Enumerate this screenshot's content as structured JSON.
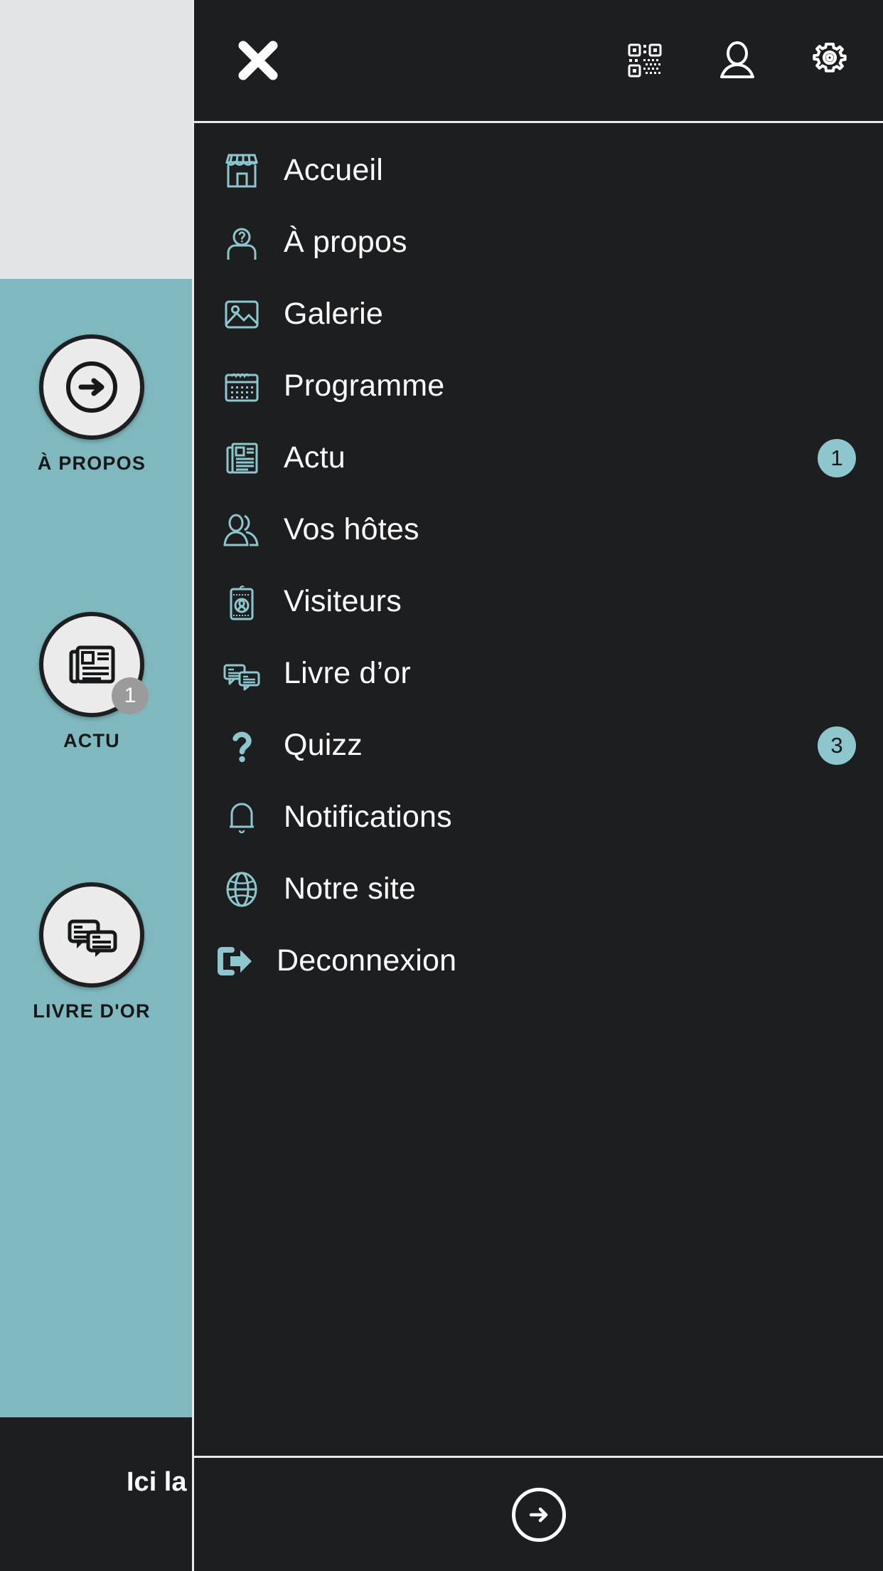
{
  "background": {
    "nav_buttons": [
      {
        "label": "À PROPOS",
        "icon": "arrow-circle-right-icon",
        "badge": null
      },
      {
        "label": "ACTU",
        "icon": "newspaper-icon",
        "badge": "1"
      },
      {
        "label": "LIVRE D'OR",
        "icon": "chat-bubbles-icon",
        "badge": null
      }
    ],
    "bottom_text": "Ici la",
    "colors": {
      "top_panel": "#e3e4e5",
      "teal_panel": "#7fb9bf",
      "bottom_bar": "#1c1e20"
    }
  },
  "drawer": {
    "header": {
      "close_icon": "close-x-icon",
      "icons": [
        {
          "name": "qr-code-icon"
        },
        {
          "name": "user-profile-icon"
        },
        {
          "name": "settings-gear-icon"
        }
      ]
    },
    "menu": [
      {
        "label": "Accueil",
        "icon": "storefront-icon",
        "badge": null
      },
      {
        "label": "À propos",
        "icon": "person-question-icon",
        "badge": null
      },
      {
        "label": "Galerie",
        "icon": "image-photo-icon",
        "badge": null
      },
      {
        "label": "Programme",
        "icon": "calendar-icon",
        "badge": null
      },
      {
        "label": "Actu",
        "icon": "newspaper-icon",
        "badge": "1"
      },
      {
        "label": "Vos hôtes",
        "icon": "two-people-icon",
        "badge": null
      },
      {
        "label": "Visiteurs",
        "icon": "id-badge-icon",
        "badge": null
      },
      {
        "label": "Livre d’or",
        "icon": "chat-bubbles-icon",
        "badge": null
      },
      {
        "label": "Quizz",
        "icon": "question-mark-icon",
        "badge": "3"
      },
      {
        "label": "Notifications",
        "icon": "bell-icon",
        "badge": null
      },
      {
        "label": "Notre site",
        "icon": "globe-icon",
        "badge": null
      },
      {
        "label": "Deconnexion",
        "icon": "logout-icon",
        "badge": null
      }
    ],
    "footer": {
      "icon": "arrow-circle-right-icon"
    },
    "colors": {
      "background": "#1c1e20",
      "accent_teal": "#8ec6cd",
      "text": "#ffffff",
      "border": "#e9e9e9"
    }
  }
}
